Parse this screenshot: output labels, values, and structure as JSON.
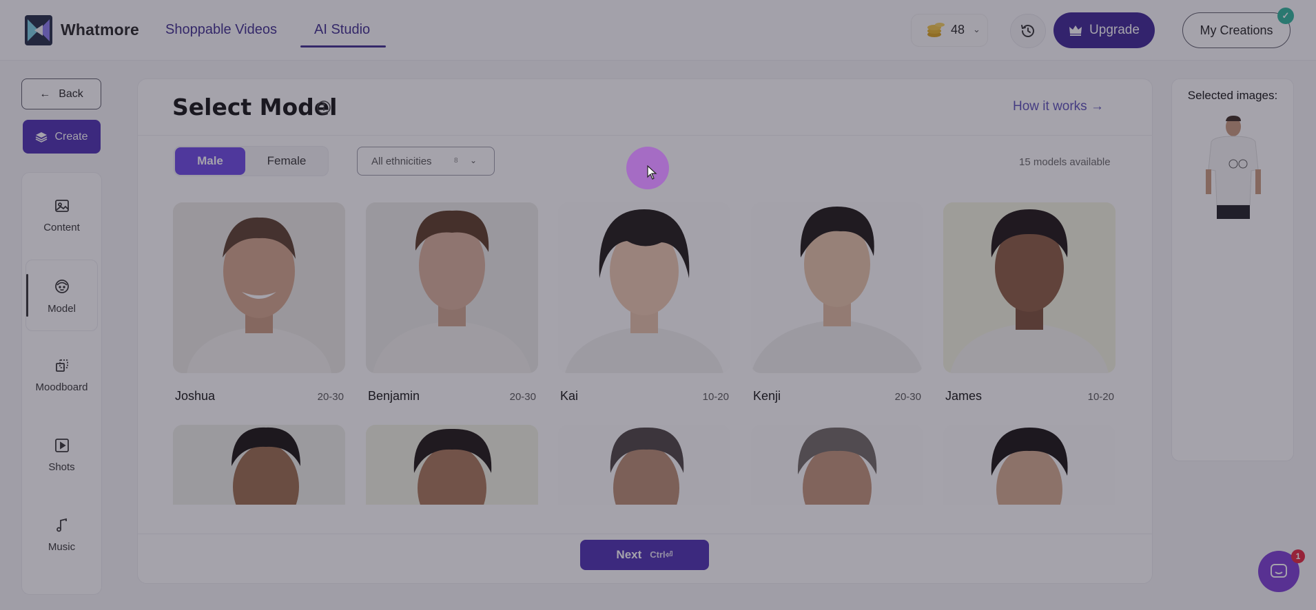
{
  "header": {
    "brand": "Whatmore",
    "tabs": [
      {
        "label": "Shoppable Videos",
        "active": false
      },
      {
        "label": "AI Studio",
        "active": true
      }
    ],
    "coins": "48",
    "upgrade_label": "Upgrade",
    "my_creations_label": "My Creations"
  },
  "sidebar": {
    "back_label": "Back",
    "create_label": "Create",
    "items": [
      {
        "label": "Content",
        "icon": "image-icon"
      },
      {
        "label": "Model",
        "icon": "model-icon",
        "active": true
      },
      {
        "label": "Moodboard",
        "icon": "moodboard-icon"
      },
      {
        "label": "Shots",
        "icon": "play-square-icon"
      },
      {
        "label": "Music",
        "icon": "music-note-icon"
      }
    ]
  },
  "main": {
    "title": "Select Model",
    "how_it_works": "How it works →",
    "gender": {
      "male": "Male",
      "female": "Female",
      "selected": "Male"
    },
    "ethnicity": {
      "label": "All ethnicities",
      "count": "8"
    },
    "models_available": "15 models available",
    "models": [
      {
        "name": "Joshua",
        "age": "20-30"
      },
      {
        "name": "Benjamin",
        "age": "20-30"
      },
      {
        "name": "Kai",
        "age": "10-20"
      },
      {
        "name": "Kenji",
        "age": "20-30"
      },
      {
        "name": "James",
        "age": "10-20"
      }
    ],
    "next_label": "Next",
    "next_shortcut": "Ctrl⏎"
  },
  "right_panel": {
    "selected_label": "Selected images:"
  },
  "chat": {
    "badge": "1"
  },
  "colors": {
    "accent": "#4a2db2",
    "toggle_active": "#6b48e6",
    "nav_text": "#3d2c8d",
    "check_badge": "#2bb59a",
    "overlay": "rgba(40,36,56,0.42)"
  }
}
